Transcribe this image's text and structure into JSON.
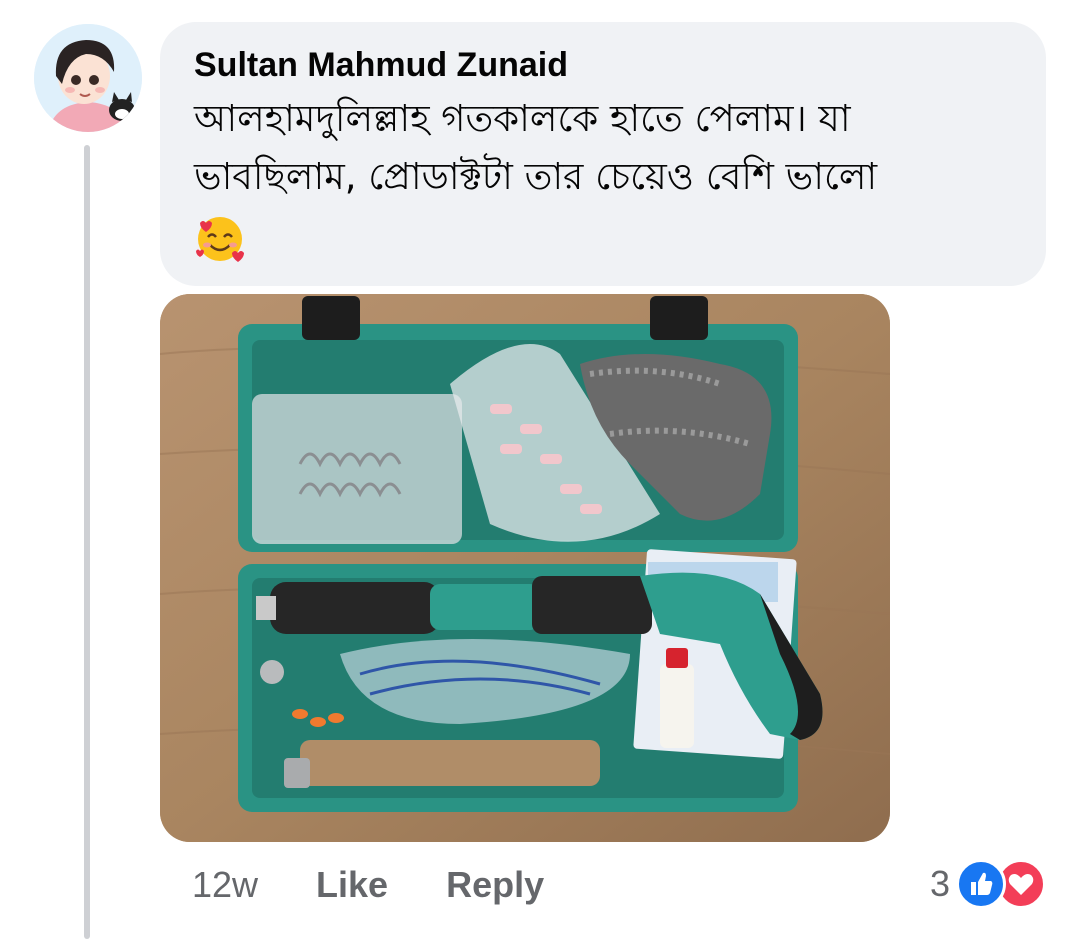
{
  "comment": {
    "author": "Sultan Mahmud Zunaid",
    "text_line1": "আলহামদুলিল্লাহ গতকালকে হাতে পেলাম। যা",
    "text_line2": "ভাবছিলাম, প্রোডাক্টটা তার চেয়েও বেশি ভালো",
    "emoji": "smiling-face-with-hearts-icon"
  },
  "photo": {
    "description_icon": "tool-case-photo"
  },
  "actions": {
    "time": "12w",
    "like_label": "Like",
    "reply_label": "Reply"
  },
  "reactions": {
    "count": "3",
    "types": [
      "like-icon",
      "love-icon"
    ]
  },
  "colors": {
    "bubble": "#f0f2f5",
    "like_blue": "#1877f2",
    "love_red": "#f33e58",
    "meta_gray": "#65676b",
    "case_teal": "#2a9384"
  }
}
